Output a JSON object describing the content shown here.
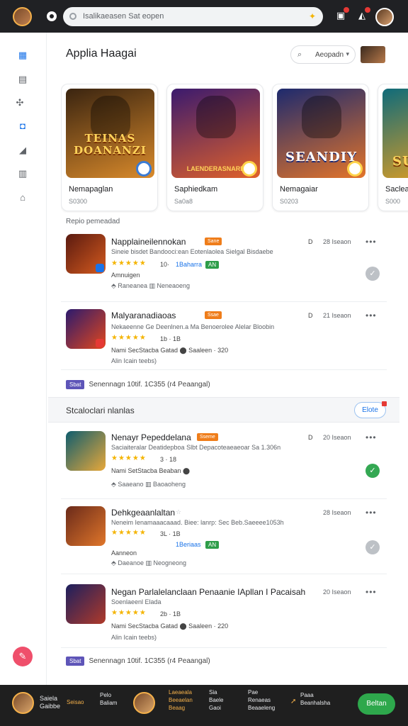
{
  "topbar": {
    "search_placeholder": "Isalikaeasen Sat eopen",
    "icons": [
      "profile-avatar",
      "circle-icon",
      "search-icon",
      "star-icon",
      "inbox-icon",
      "notifications-icon",
      "user-avatar"
    ]
  },
  "rail": {
    "items": [
      "apps-icon",
      "calendar-icon",
      "puzzle-icon",
      "chat-icon",
      "trend-icon",
      "grid-icon",
      "home-icon"
    ],
    "fab": "compose-icon"
  },
  "header": {
    "title": "Applia Haagai",
    "sort_label": "Aeopadn"
  },
  "featured": [
    {
      "art_title": "TEINAS\nDOANANZI",
      "art_sub": "",
      "name": "Nemapaglan",
      "meta": "S0300",
      "colors": [
        "#3a2410",
        "#d98a2b"
      ]
    },
    {
      "art_title": "",
      "art_sub": "LAENDERASNARE",
      "name": "Saphiedkam",
      "meta": "Sa0a8",
      "colors": [
        "#3b1a6e",
        "#e0612a"
      ]
    },
    {
      "art_title": "SEANDIY",
      "art_sub": "",
      "name": "Nemagaiar",
      "meta": "S0203",
      "colors": [
        "#1d2a6e",
        "#e3742a"
      ]
    },
    {
      "art_title": "SU",
      "art_sub": "",
      "name": "Saclea",
      "meta": "S000",
      "colors": [
        "#0f6b7a",
        "#f0a21b"
      ]
    }
  ],
  "section_label": "Repio pemeadad",
  "rows_top": [
    {
      "title": "Napplaineilennokan",
      "tag": "Sane",
      "desc": "Sineie bisdet Bandooci:ean Eotenlaolea Sielgal Bisdaebe",
      "stars": "★★★★★",
      "rating": "10· ",
      "pill_blue": "1Baharra",
      "pill": "AN",
      "line3": "Amnuigen",
      "line4": "⬘ Raneanea  ▥ Neneaoeng",
      "num": "D",
      "time": "28 Iseaon",
      "state": "grey",
      "colors": [
        "#5a1a10",
        "#d45a1e"
      ]
    },
    {
      "title": "Malyaranadiaoas",
      "tag": "Ssae",
      "desc": "Nekaeenne Ge Deenlnen.a Ma Benoerolee Alelar Bloobin",
      "stars": "★★★★★",
      "rating": "1b · 1B",
      "pill_blue": "",
      "pill": "",
      "line3": "Nami SecStacba  Gatad  ⬤ Saaleen  · 320",
      "line4": "Alin Icain teebs)",
      "num": "D",
      "time": "21 Iseaon",
      "state": "",
      "colors": [
        "#2b1a6e",
        "#e2471c"
      ]
    }
  ],
  "storage_1": {
    "chip": "Sbat",
    "text": "Senennagn  10tif. 1C355 (r4 Peaangal)"
  },
  "subhead": {
    "label": "Stcaloclari nlanlas",
    "button": "Elote"
  },
  "rows_bottom": [
    {
      "title": "Nenayr Pepeddelana",
      "tag": "Sseme",
      "desc": "Saciaiteralar Deatidepboa Slbt Depacoteaeaeoar Sa 1.306n",
      "stars": "★★★★★",
      "rating": "3 · 18",
      "pill_blue": "Beaban",
      "pill": "",
      "line3": "Nami SetStacba  Beaban ⬤",
      "line4": "⬘ Saaeano  ▥ Baoaoheng",
      "num": "D",
      "time": "20 Iseaon",
      "state": "green",
      "colors": [
        "#0f5d6e",
        "#e8a83a"
      ]
    },
    {
      "title": "Dehkgeaanlaltan",
      "tag": "",
      "desc": "Neneim Ienamaaacaaad. Biee: lanrp: Sec Beb.Saeeee1053h",
      "stars": "★★★★★",
      "rating": "3L · 1B",
      "pill_blue": "1Beriaas",
      "pill": "AN",
      "line3": "Aanneon",
      "line4": "⬘ Daeanoe  ▥ Neogneong",
      "num": "",
      "time": "28 Iseaon",
      "state": "grey",
      "colors": [
        "#6a2a1a",
        "#e0762a"
      ]
    },
    {
      "title": "Negan Parlalelanclaan Penaanie IApllan I Pacaisah",
      "tag": "",
      "desc": "Soenlaeenl Elada",
      "stars": "★★★★★",
      "rating": "2b · 1B",
      "pill_blue": "",
      "pill": "",
      "line3": "Nami SecStacba  Gatad  ⬤ Saaleen  · 220",
      "line4": "Alin Icain teebs)",
      "num": "",
      "time": "20 Iseaon",
      "state": "",
      "colors": [
        "#1c1f5e",
        "#b03a2a"
      ]
    }
  ],
  "storage_2": {
    "chip": "Sbat",
    "text": "Senennagn  10tif. 1C355 (r4 Peaangal)"
  },
  "bottombar": {
    "user_name": "Saiela\nGaibbe",
    "col1": "Seisao",
    "col2": "Pelo\nBaliam",
    "col3": "Laeaeala\nBeeaelan\nBeaag",
    "col4": "Sia\nBaele\nGaoi",
    "col5": "Pae\nRenaeas\nBeaaeleng",
    "col6": "Paaa\nBeanhalsha",
    "action": "Beltan"
  },
  "accent_colors": {
    "blue": "#1a73e8",
    "green": "#34a853",
    "orange": "#ef7d1a",
    "purple": "#5e55b8",
    "gold": "#f4b400"
  }
}
